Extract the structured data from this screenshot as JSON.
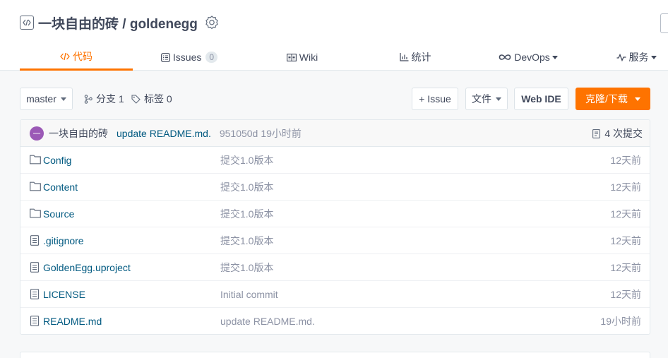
{
  "repo": {
    "title": "一块自由的砖 / goldenegg"
  },
  "tabs": [
    {
      "label": "代码",
      "icon": "code-icon"
    },
    {
      "label": "Issues",
      "count": "0",
      "icon": "issues-icon"
    },
    {
      "label": "Wiki",
      "icon": "wiki-icon"
    },
    {
      "label": "统计",
      "icon": "stats-icon"
    },
    {
      "label": "DevOps",
      "icon": "devops-icon"
    },
    {
      "label": "服务",
      "icon": "service-icon"
    }
  ],
  "toolbar": {
    "branch": "master",
    "branches_label": "分支 1",
    "tags_label": "标签 0",
    "issue_button": "+ Issue",
    "file_button": "文件",
    "webide_button": "Web IDE",
    "clone_button": "克隆/下载"
  },
  "commit": {
    "avatar_letter": "一",
    "author": "一块自由的砖",
    "message": "update README.md.",
    "sha": "951050d",
    "time": "19小时前",
    "count_label": "4 次提交"
  },
  "files": [
    {
      "name": "Config",
      "type": "folder",
      "message": "提交1.0版本",
      "time": "12天前"
    },
    {
      "name": "Content",
      "type": "folder",
      "message": "提交1.0版本",
      "time": "12天前"
    },
    {
      "name": "Source",
      "type": "folder",
      "message": "提交1.0版本",
      "time": "12天前"
    },
    {
      "name": ".gitignore",
      "type": "file",
      "message": "提交1.0版本",
      "time": "12天前"
    },
    {
      "name": "GoldenEgg.uproject",
      "type": "file",
      "message": "提交1.0版本",
      "time": "12天前"
    },
    {
      "name": "LICENSE",
      "type": "file",
      "message": "Initial commit",
      "time": "12天前"
    },
    {
      "name": "README.md",
      "type": "file",
      "message": "update README.md.",
      "time": "19小时前"
    }
  ],
  "colors": {
    "accent": "#fe7300",
    "link": "#005980",
    "muted": "#8c92a4",
    "avatar": "#9b59b6"
  }
}
